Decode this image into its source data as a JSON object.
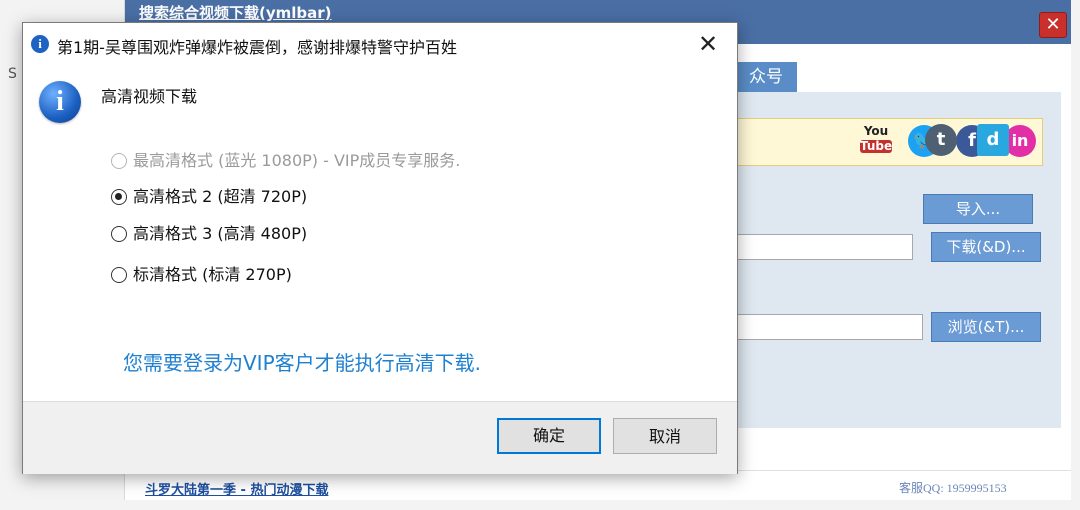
{
  "background_app": {
    "title": "搜索综合视频下载(ymlbar)",
    "close_glyph": "✕",
    "tab_label": "众号",
    "import_label": "导入...",
    "download_label": "下载(&D)...",
    "browse_label": "浏览(&T)...",
    "bottom_link": "斗罗大陆第一季 - 热门动漫下载",
    "support_qq": "客服QQ: 1959995153",
    "edge_letter": "S",
    "social_icons": [
      {
        "name": "youtube-icon",
        "glyph_top": "You",
        "glyph_bottom": "Tube",
        "color": "#c4302b"
      },
      {
        "name": "twitter-icon",
        "glyph": "🐦",
        "color": "#1da1f2"
      },
      {
        "name": "facebook-icon",
        "glyph": "f",
        "color": "#3b5998"
      },
      {
        "name": "linkedin-icon",
        "glyph": "in",
        "color": "#e22fa6"
      },
      {
        "name": "tumblr-icon",
        "glyph": "t",
        "color": "#4e6072"
      },
      {
        "name": "dailymotion-icon",
        "glyph": "d",
        "color": "#29a8e0"
      }
    ]
  },
  "dialog": {
    "title": "第1期-吴尊围观炸弹爆炸被震倒，感谢排爆特警守护百姓",
    "close_glyph": "✕",
    "heading": "高清视频下载",
    "options": [
      {
        "label": "最高清格式 (蓝光 1080P) - VIP成员专享服务.",
        "selected": false,
        "disabled": true
      },
      {
        "label": "高清格式 2 (超清 720P)",
        "selected": true,
        "disabled": false
      },
      {
        "label": "高清格式 3 (高清 480P)",
        "selected": false,
        "disabled": false
      },
      {
        "label": "标清格式 (标清 270P)",
        "selected": false,
        "disabled": false
      }
    ],
    "notice": "您需要登录为VIP客户才能执行高清下载.",
    "ok_label": "确定",
    "cancel_label": "取消",
    "info_glyph": "i",
    "accent_color": "#0078d7",
    "notice_color": "#1f80d0"
  }
}
